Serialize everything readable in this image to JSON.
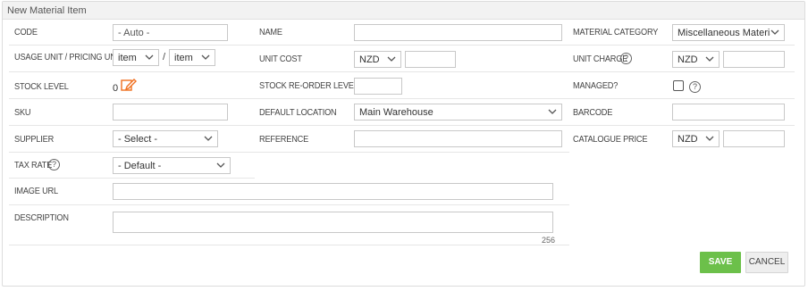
{
  "header": {
    "title": "New Material Item"
  },
  "labels": {
    "code": "CODE",
    "usage_unit": "USAGE UNIT / PRICING UNIT",
    "stock_level": "STOCK LEVEL",
    "sku": "SKU",
    "supplier": "SUPPLIER",
    "tax_rate": "TAX RATE",
    "image_url": "IMAGE URL",
    "description": "DESCRIPTION",
    "name": "NAME",
    "unit_cost": "UNIT COST",
    "stock_reorder": "STOCK RE-ORDER LEVEL",
    "default_location": "DEFAULT LOCATION",
    "reference": "REFERENCE",
    "material_category": "MATERIAL CATEGORY",
    "unit_charge": "UNIT CHARGE",
    "managed": "MANAGED?",
    "barcode": "BARCODE",
    "catalogue_price": "CATALOGUE PRICE"
  },
  "fields": {
    "code_value": "- Auto -",
    "usage_unit_value": "item",
    "unit_separator": "/",
    "pricing_unit_value": "item",
    "stock_level_value": "0",
    "supplier_value": "- Select -",
    "tax_rate_value": "- Default -",
    "unit_cost_currency": "NZD",
    "default_location_value": "Main Warehouse",
    "material_category_value": "Miscellaneous Material",
    "unit_charge_currency": "NZD",
    "catalogue_price_currency": "NZD",
    "description_counter": "256"
  },
  "help_glyph": "?",
  "buttons": {
    "save": "SAVE",
    "cancel": "CANCEL"
  },
  "colors": {
    "save_bg": "#6cc04a",
    "edit_icon": "#f07020"
  },
  "icons": [
    "chevron-down-icon",
    "help-icon",
    "edit-icon",
    "checkbox"
  ]
}
